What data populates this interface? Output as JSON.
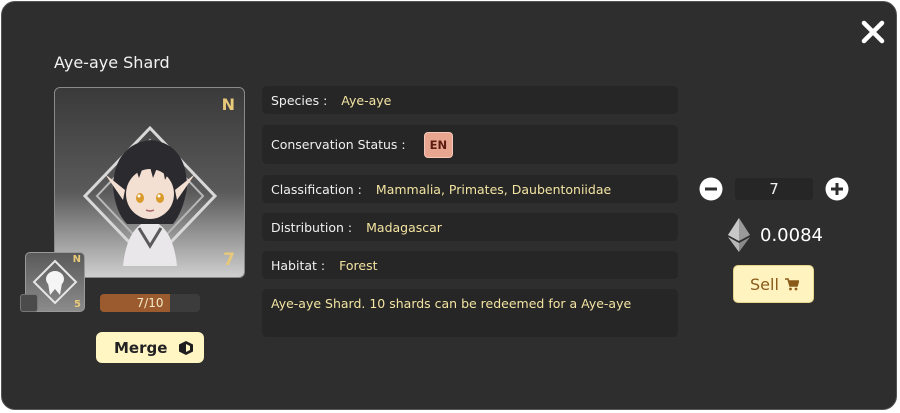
{
  "dialog": {
    "title": "Aye-aye Shard",
    "close_icon": "close-icon"
  },
  "card": {
    "rarity": "N",
    "count": "7",
    "art": "chibi-character-portrait"
  },
  "mini_card": {
    "rarity": "N",
    "count": "5",
    "art": "ghost-silhouette-icon"
  },
  "progress": {
    "label": "7/10",
    "current": 7,
    "max": 10,
    "fill_color": "#9c5b2e"
  },
  "merge": {
    "label": "Merge",
    "icon": "merge-cube-icon"
  },
  "info": {
    "species_key": "Species :",
    "species_val": "Aye-aye",
    "status_key": "Conservation Status :",
    "status_val": "EN",
    "class_key": "Classification :",
    "class_val": "Mammalia, Primates, Daubentoniidae",
    "dist_key": "Distribution :",
    "dist_val": "Madagascar",
    "habitat_key": "Habitat :",
    "habitat_val": "Forest",
    "description": "Aye-aye Shard. 10 shards can be redeemed for a Aye-aye"
  },
  "trade": {
    "quantity": "7",
    "price": "0.0084",
    "currency_icon": "ethereum-icon",
    "sell_label": "Sell",
    "sell_icon": "cart-icon"
  },
  "colors": {
    "panel": "#2e2e2e",
    "value_text": "#f3e4a2",
    "accent_gold": "#e8c979",
    "badge_en": "#e8a691",
    "button_bg": "#fff3c0"
  }
}
